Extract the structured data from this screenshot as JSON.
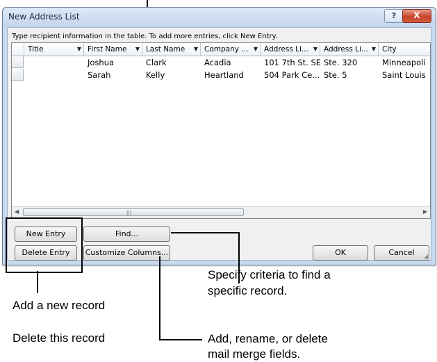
{
  "dialog": {
    "title": "New Address List",
    "help_label": "?",
    "close_label": "X",
    "instruction": "Type recipient information in the table.  To add more entries, click New Entry.",
    "columns": [
      "Title",
      "First Name",
      "Last Name",
      "Company ...",
      "Address Li...",
      "Address Li...",
      "City"
    ],
    "rows": [
      [
        "",
        "Joshua",
        "Clark",
        "Acadia",
        "101 7th St. SE",
        "Ste. 320",
        "Minneapoli"
      ],
      [
        "",
        "Sarah",
        "Kelly",
        "Heartland",
        "504 Park Ce...",
        "Ste. 5",
        "Saint Louis"
      ]
    ],
    "buttons": {
      "new_entry": "New Entry",
      "delete_entry": "Delete Entry",
      "find": "Find...",
      "customize_columns": "Customize Columns...",
      "ok": "OK",
      "cancel": "Cancel"
    }
  },
  "annotations": {
    "add_record": "Add a new record",
    "delete_record": "Delete this record",
    "find_line1": "Specify criteria to find a",
    "find_line2": "specific record.",
    "customize_line1": "Add, rename, or delete",
    "customize_line2": "mail merge fields."
  },
  "icons": {
    "dropdown": "chevron-down-icon",
    "scroll_left": "arrow-left-icon",
    "scroll_right": "arrow-right-icon",
    "grip": "grip-icon"
  }
}
